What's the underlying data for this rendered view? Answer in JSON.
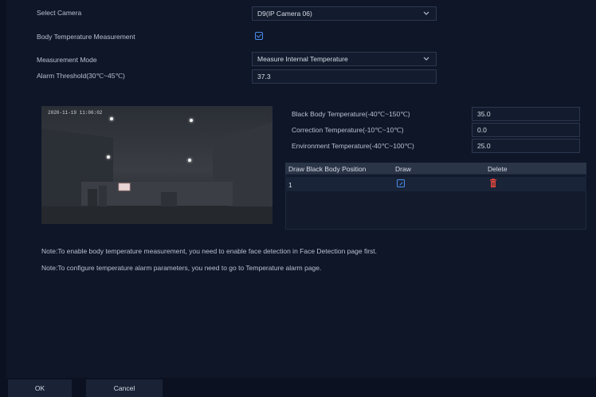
{
  "form": {
    "camera_label": "Select Camera",
    "camera_value": "D9(IP Camera 06)",
    "body_temp_label": "Body Temperature Measurement",
    "body_temp_checked": true,
    "mode_label": "Measurement Mode",
    "mode_value": "Measure Internal Temperature",
    "alarm_label": "Alarm Threshold(30℃~45℃)",
    "alarm_value": "37.3"
  },
  "preview": {
    "timestamp": "2020-11-19 11:06:02"
  },
  "temps": {
    "black_body_label": "Black Body Temperature(-40℃~150℃)",
    "black_body_value": "35.0",
    "correction_label": "Correction Temperature(-10℃~10℃)",
    "correction_value": "0.0",
    "environment_label": "Environment Temperature(-40℃~100℃)",
    "environment_value": "25.0"
  },
  "table": {
    "headers": [
      "Draw Black Body Position",
      "Draw",
      "Delete"
    ],
    "rows": [
      {
        "position": "1"
      }
    ]
  },
  "notes": [
    "Note:To enable body temperature measurement, you need to enable face detection in Face Detection page first.",
    "Note:To configure temperature alarm parameters, you need to go to Temperature alarm page."
  ],
  "buttons": {
    "ok": "OK",
    "cancel": "Cancel"
  },
  "icons": {
    "dropdown": "chevron-down-icon",
    "draw": "edit-icon",
    "delete": "trash-icon"
  },
  "colors": {
    "accent": "#4b8dea",
    "delete": "#e0463c"
  }
}
